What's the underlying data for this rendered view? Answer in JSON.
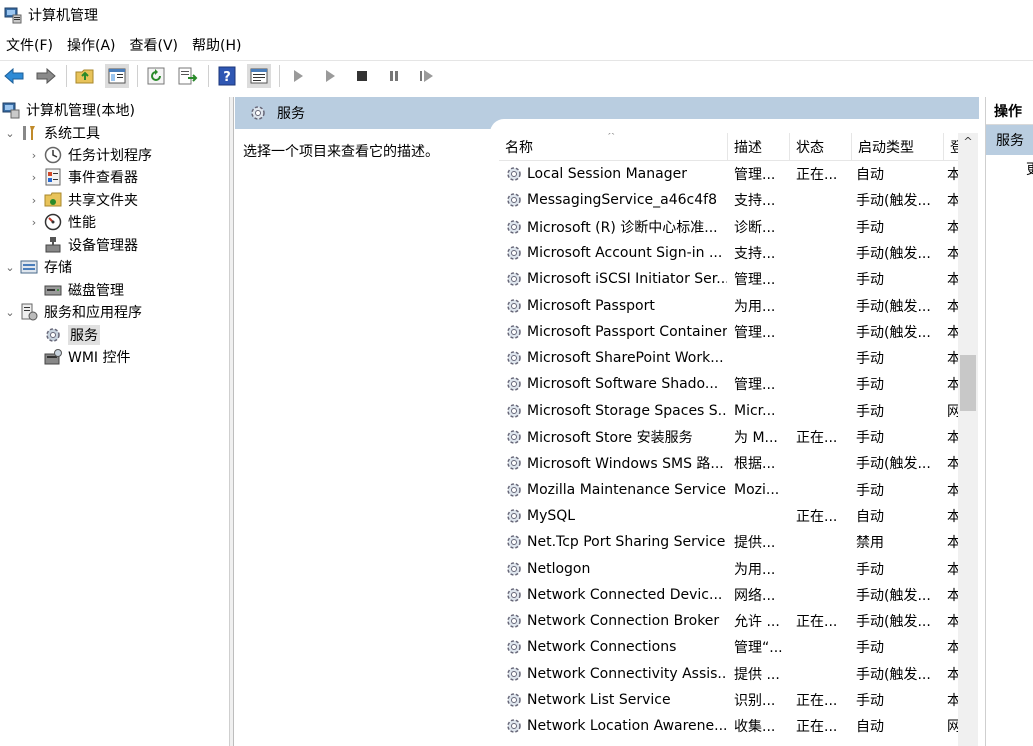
{
  "window": {
    "title": "计算机管理"
  },
  "menu": [
    "文件(F)",
    "操作(A)",
    "查看(V)",
    "帮助(H)"
  ],
  "tree": [
    {
      "label": "计算机管理(本地)",
      "expander": "",
      "icon": "computer-management-icon",
      "level": 0
    },
    {
      "label": "系统工具",
      "expander": "⌄",
      "icon": "tools-icon",
      "level": 1
    },
    {
      "label": "任务计划程序",
      "expander": "›",
      "icon": "clock-icon",
      "level": 2
    },
    {
      "label": "事件查看器",
      "expander": "›",
      "icon": "event-viewer-icon",
      "level": 2
    },
    {
      "label": "共享文件夹",
      "expander": "›",
      "icon": "shared-folder-icon",
      "level": 2
    },
    {
      "label": "性能",
      "expander": "›",
      "icon": "performance-icon",
      "level": 2
    },
    {
      "label": "设备管理器",
      "expander": "",
      "icon": "device-manager-icon",
      "level": 2
    },
    {
      "label": "存储",
      "expander": "⌄",
      "icon": "storage-icon",
      "level": 1
    },
    {
      "label": "磁盘管理",
      "expander": "",
      "icon": "disk-icon",
      "level": 2
    },
    {
      "label": "服务和应用程序",
      "expander": "⌄",
      "icon": "services-apps-icon",
      "level": 1
    },
    {
      "label": "服务",
      "expander": "",
      "icon": "gear-icon",
      "level": 2,
      "selected": true
    },
    {
      "label": "WMI 控件",
      "expander": "",
      "icon": "wmi-icon",
      "level": 2
    }
  ],
  "center": {
    "header_title": "服务",
    "description_prompt": "选择一个项目来查看它的描述。",
    "columns": {
      "name": "名称",
      "desc": "描述",
      "status": "状态",
      "startup": "启动类型",
      "logon": "登"
    },
    "rows": [
      {
        "name": "Local Session Manager",
        "desc": "管理...",
        "status": "正在...",
        "startup": "自动",
        "logon": "本"
      },
      {
        "name": "MessagingService_a46c4f8",
        "desc": "支持...",
        "status": "",
        "startup": "手动(触发...",
        "logon": "本"
      },
      {
        "name": "Microsoft (R) 诊断中心标准...",
        "desc": "诊断...",
        "status": "",
        "startup": "手动",
        "logon": "本"
      },
      {
        "name": "Microsoft Account Sign-in ...",
        "desc": "支持...",
        "status": "",
        "startup": "手动(触发...",
        "logon": "本"
      },
      {
        "name": "Microsoft iSCSI Initiator Ser...",
        "desc": "管理...",
        "status": "",
        "startup": "手动",
        "logon": "本"
      },
      {
        "name": "Microsoft Passport",
        "desc": "为用...",
        "status": "",
        "startup": "手动(触发...",
        "logon": "本"
      },
      {
        "name": "Microsoft Passport Container",
        "desc": "管理...",
        "status": "",
        "startup": "手动(触发...",
        "logon": "本"
      },
      {
        "name": "Microsoft SharePoint Work...",
        "desc": "",
        "status": "",
        "startup": "手动",
        "logon": "本"
      },
      {
        "name": "Microsoft Software Shado...",
        "desc": "管理...",
        "status": "",
        "startup": "手动",
        "logon": "本"
      },
      {
        "name": "Microsoft Storage Spaces S...",
        "desc": "Micr...",
        "status": "",
        "startup": "手动",
        "logon": "网"
      },
      {
        "name": "Microsoft Store 安装服务",
        "desc": "为 M...",
        "status": "正在...",
        "startup": "手动",
        "logon": "本"
      },
      {
        "name": "Microsoft Windows SMS 路...",
        "desc": "根据...",
        "status": "",
        "startup": "手动(触发...",
        "logon": "本"
      },
      {
        "name": "Mozilla Maintenance Service",
        "desc": "Mozi...",
        "status": "",
        "startup": "手动",
        "logon": "本"
      },
      {
        "name": "MySQL",
        "desc": "",
        "status": "正在...",
        "startup": "自动",
        "logon": "本"
      },
      {
        "name": "Net.Tcp Port Sharing Service",
        "desc": "提供...",
        "status": "",
        "startup": "禁用",
        "logon": "本"
      },
      {
        "name": "Netlogon",
        "desc": "为用...",
        "status": "",
        "startup": "手动",
        "logon": "本"
      },
      {
        "name": "Network Connected Devic...",
        "desc": "网络...",
        "status": "",
        "startup": "手动(触发...",
        "logon": "本"
      },
      {
        "name": "Network Connection Broker",
        "desc": "允许 ...",
        "status": "正在...",
        "startup": "手动(触发...",
        "logon": "本"
      },
      {
        "name": "Network Connections",
        "desc": "管理“...",
        "status": "",
        "startup": "手动",
        "logon": "本"
      },
      {
        "name": "Network Connectivity Assis...",
        "desc": "提供 ...",
        "status": "",
        "startup": "手动(触发...",
        "logon": "本"
      },
      {
        "name": "Network List Service",
        "desc": "识别...",
        "status": "正在...",
        "startup": "手动",
        "logon": "本"
      },
      {
        "name": "Network Location Awarene...",
        "desc": "收集...",
        "status": "正在...",
        "startup": "自动",
        "logon": "网"
      }
    ]
  },
  "actions": {
    "header": "操作",
    "selected": "服务",
    "more": "更"
  },
  "colors": {
    "header_blue": "#b9cde0",
    "selection_gray": "#e0e0e0"
  }
}
